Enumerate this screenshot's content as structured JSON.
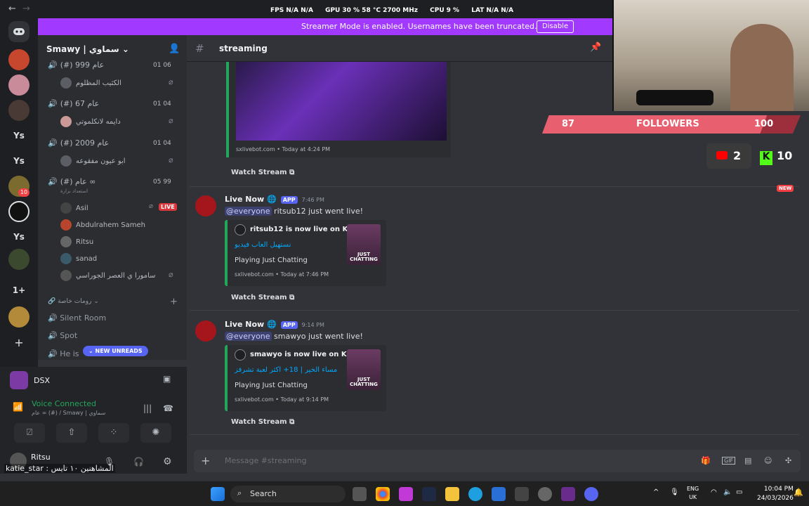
{
  "perf": {
    "fps_label": "FPS",
    "fps_value": "N/A N/A",
    "gpu_label": "GPU",
    "gpu_value": "30 % 58 °C 2700 MHz",
    "cpu_label": "CPU",
    "cpu_value": "9 %",
    "lat_label": "LAT",
    "lat_value": "N/A N/A",
    "window_title": "Smawy | ..."
  },
  "banner": {
    "text": "Streamer Mode is enabled. Usernames have been truncated.",
    "button": "Disable"
  },
  "rail": {
    "servers": [
      "Ys",
      "Ys",
      "Ys",
      "1+"
    ],
    "badge": "10"
  },
  "sidebar": {
    "server_name": "Smawy | سماوي",
    "voice_channels": [
      {
        "name": "(#) 999 عام",
        "count": "01 06",
        "member": "الكثيب المظلوم"
      },
      {
        "name": "(#) 67 عام",
        "count": "01 04",
        "member": "دايمه لانكلموتي"
      },
      {
        "name": "(#) 2009 عام",
        "count": "01 04",
        "member": "ابو عيون مفقوعه"
      },
      {
        "name": "(#) عام ∞",
        "count": "05 99",
        "sub": "استعداد بزارة"
      }
    ],
    "members": [
      "Asil",
      "Abdulrahem Sameh",
      "Ritsu",
      "sanad",
      "سامورا ي العصر الجوراسي"
    ],
    "live_label": "LIVE",
    "category": "رومات خاصة",
    "text_channels": [
      "Silent Room",
      "Spot",
      "He is"
    ],
    "new_unreads": "NEW UNREADS"
  },
  "panel": {
    "activity_name": "DSX",
    "voice_status": "Voice Connected",
    "voice_sub": "عام ∞ (#) / Smawy | سماوي",
    "username": "Ritsu",
    "custom_status": "katie_star : المشاهنين ١٠ تايس"
  },
  "channel": {
    "name": "streaming"
  },
  "overlay": {
    "followers_current": "87",
    "followers_label": "FOLLOWERS",
    "followers_goal": "100",
    "followers_progress": 0.87,
    "youtube_count": "2",
    "kick_count": "10"
  },
  "messages": [
    {
      "embed_footer": "sxlivebot.com • Today at 4:24 PM",
      "watch": "Watch Stream"
    },
    {
      "author": "Live Now",
      "app_tag": "APP",
      "time": "7:46 PM",
      "mention": "@everyone",
      "text": "ritsub12 just went live!",
      "embed_title": "ritsub12 is now live on Kick!",
      "embed_link": "نستهبل العاب فيديو",
      "playing": "Playing Just Chatting",
      "embed_footer": "sxlivebot.com • Today at 7:46 PM",
      "thumb": "JUST CHATTING",
      "watch": "Watch Stream"
    },
    {
      "author": "Live Now",
      "app_tag": "APP",
      "time": "9:14 PM",
      "mention": "@everyone",
      "text": "smawyo just went live!",
      "embed_title": "smawyo is now live on Kick!",
      "embed_link": "مساء الخير | 18+ اكثر لعبة تشرفز",
      "playing": "Playing Just Chatting",
      "embed_footer": "sxlivebot.com • Today at 9:14 PM",
      "thumb": "JUST CHATTING",
      "watch": "Watch Stream"
    }
  ],
  "new_badge": "NEW",
  "composer": {
    "placeholder": "Message #streaming"
  },
  "taskbar": {
    "search": "Search",
    "lang_top": "ENG",
    "lang_bottom": "UK",
    "time": "10:04 PM",
    "date": "24/03/2026"
  },
  "colors": {
    "streamer_banner": "#a239ff",
    "voice_connected": "#23a55a",
    "kick_green": "#53fc18",
    "live_red": "#da373c"
  }
}
